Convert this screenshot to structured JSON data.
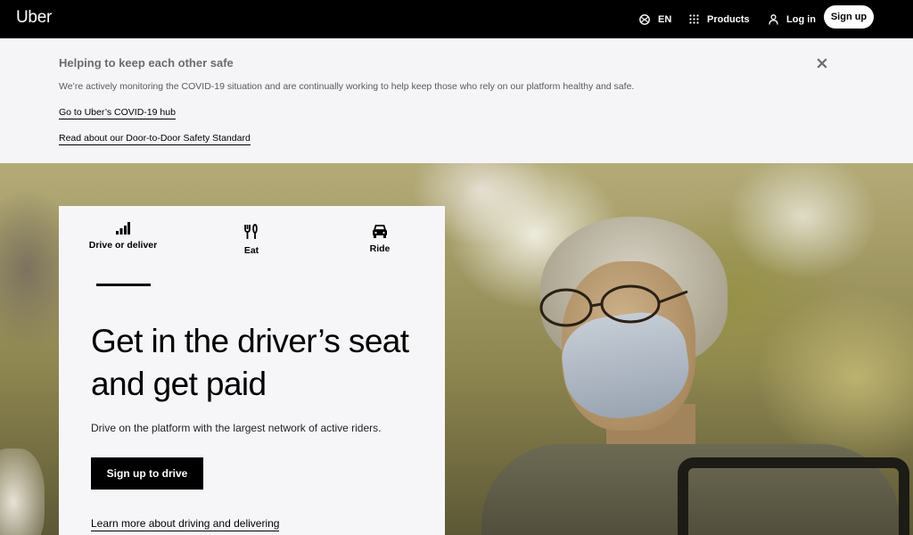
{
  "nav": {
    "logo": "Uber",
    "language": "EN",
    "products": "Products",
    "login": "Log in",
    "signup": "Sign up"
  },
  "banner": {
    "title": "Helping to keep each other safe",
    "text": "We’re actively monitoring the COVID-19 situation and are continually working to help keep those who rely on our platform healthy and safe.",
    "link_hub": "Go to Uber’s COVID-19 hub",
    "link_safety": "Read about our Door-to-Door Safety Standard"
  },
  "hero": {
    "tabs": [
      {
        "label": "Drive or deliver",
        "icon": "signal-bars-icon",
        "active": true
      },
      {
        "label": "Eat",
        "icon": "fork-knife-icon",
        "active": false
      },
      {
        "label": "Ride",
        "icon": "car-icon",
        "active": false
      }
    ],
    "headline": "Get in the driver’s seat and get paid",
    "subtext": "Drive on the platform with the largest network of active riders.",
    "cta": "Sign up to drive",
    "learn_more": "Learn more about driving and delivering"
  },
  "colors": {
    "nav_bg": "#000000",
    "banner_bg": "#f5f5f8",
    "card_bg": "#f6f6f9",
    "cta_bg": "#000000"
  }
}
